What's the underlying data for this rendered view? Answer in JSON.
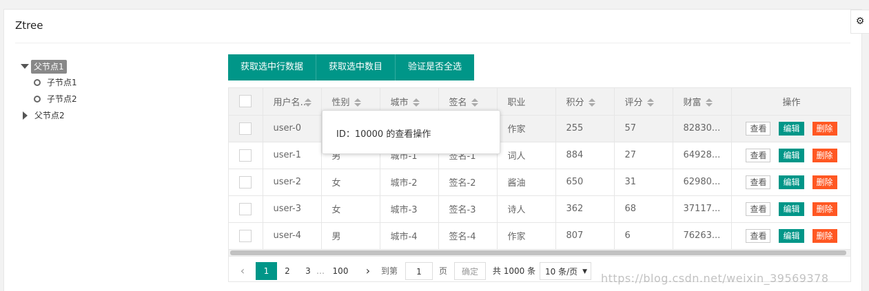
{
  "panel": {
    "title": "Ztree",
    "settings_icon": "gear-icon"
  },
  "tree": {
    "nodes": [
      {
        "label": "父节点1",
        "expanded": true,
        "selected": true
      },
      {
        "label": "子节点1"
      },
      {
        "label": "子节点2"
      },
      {
        "label": "父节点2",
        "expanded": false
      }
    ]
  },
  "toolbar": {
    "buttons": [
      "获取选中行数据",
      "获取选中数目",
      "验证是否全选"
    ],
    "color": "#009688"
  },
  "table": {
    "headers": [
      "用户名",
      "性别",
      "城市",
      "签名",
      "职业",
      "积分",
      "评分",
      "财富",
      "操作"
    ],
    "actions": {
      "view": "查看",
      "edit": "编辑",
      "delete": "删除"
    },
    "rows": [
      {
        "username": "user-0",
        "sex": "",
        "city": "",
        "sign": "",
        "job": "作家",
        "points": "255",
        "score": "57",
        "wealth": "82830..."
      },
      {
        "username": "user-1",
        "sex": "男",
        "city": "城市-1",
        "sign": "签名-1",
        "job": "词人",
        "points": "884",
        "score": "27",
        "wealth": "64928..."
      },
      {
        "username": "user-2",
        "sex": "女",
        "city": "城市-2",
        "sign": "签名-2",
        "job": "酱油",
        "points": "650",
        "score": "31",
        "wealth": "62980..."
      },
      {
        "username": "user-3",
        "sex": "女",
        "city": "城市-3",
        "sign": "签名-3",
        "job": "诗人",
        "points": "362",
        "score": "68",
        "wealth": "37117..."
      },
      {
        "username": "user-4",
        "sex": "男",
        "city": "城市-4",
        "sign": "签名-4",
        "job": "作家",
        "points": "807",
        "score": "6",
        "wealth": "76263..."
      }
    ]
  },
  "pager": {
    "prev": "‹",
    "next": "›",
    "pages": [
      "1",
      "2",
      "3"
    ],
    "ellipsis": "…",
    "last": "100",
    "goto_label": "到第",
    "goto_value": "1",
    "page_unit": "页",
    "confirm": "确定",
    "total": "共 1000 条",
    "page_size": "10 条/页",
    "select_arrow": "▼"
  },
  "tooltip": {
    "text": "ID：10000 的查看操作"
  },
  "watermark": "https://blog.csdn.net/weixin_39569378"
}
